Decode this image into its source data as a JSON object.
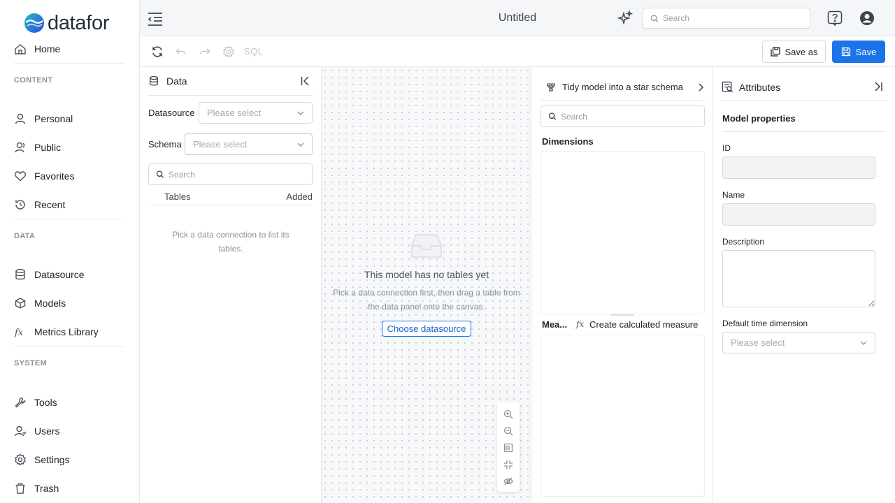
{
  "brand": {
    "name": "datafor"
  },
  "sidebar": {
    "home": "Home",
    "sections": {
      "content": "CONTENT",
      "data": "DATA",
      "system": "SYSTEM"
    },
    "content_items": [
      {
        "label": "Personal",
        "icon": "person-icon"
      },
      {
        "label": "Public",
        "icon": "people-icon"
      },
      {
        "label": "Favorites",
        "icon": "heart-icon"
      },
      {
        "label": "Recent",
        "icon": "history-icon"
      }
    ],
    "data_items": [
      {
        "label": "Datasource",
        "icon": "database-icon"
      },
      {
        "label": "Models",
        "icon": "cube-icon"
      },
      {
        "label": "Metrics Library",
        "icon": "fx-icon"
      }
    ],
    "system_items": [
      {
        "label": "Tools",
        "icon": "wrench-icon"
      },
      {
        "label": "Users",
        "icon": "users-icon"
      },
      {
        "label": "Settings",
        "icon": "gear-icon"
      },
      {
        "label": "Trash",
        "icon": "trash-icon"
      }
    ]
  },
  "topbar": {
    "title": "Untitled",
    "search_placeholder": "Search"
  },
  "toolbar": {
    "sql_label": "SQL",
    "save_as_label": "Save as",
    "save_label": "Save"
  },
  "data_panel": {
    "title": "Data",
    "datasource_label": "Datasource",
    "datasource_placeholder": "Please select",
    "schema_label": "Schema",
    "schema_placeholder": "Please select",
    "search_placeholder": "Search",
    "col_tables": "Tables",
    "col_added": "Added",
    "empty_text": "Pick a data connection to list its tables."
  },
  "canvas": {
    "empty_title": "This model has no tables yet",
    "empty_desc": "Pick a data connection first, then drag a table from the data panel onto the canvas.",
    "choose_button": "Choose datasource"
  },
  "model_panel": {
    "header": "Tidy model into a star schema",
    "search_placeholder": "Search",
    "dimensions_title": "Dimensions",
    "measures_title": "Mea...",
    "fx_label": "fx",
    "create_measure": "Create calculated measure"
  },
  "attributes": {
    "title": "Attributes",
    "section": "Model properties",
    "id_label": "ID",
    "id_value": "",
    "name_label": "Name",
    "name_value": "",
    "description_label": "Description",
    "default_time_label": "Default time dimension",
    "default_time_placeholder": "Please select"
  },
  "colors": {
    "primary": "#1a73e8",
    "logo_blue": "#2b6fd6",
    "logo_teal": "#27b6c9"
  }
}
